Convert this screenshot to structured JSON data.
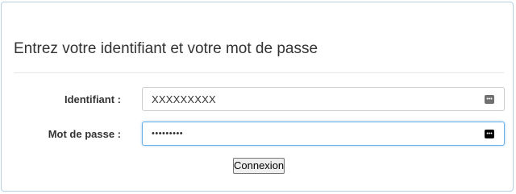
{
  "login_panel": {
    "title": "Entrez votre identifiant et votre mot de passe",
    "username_label": "Identifiant :",
    "username_value": "XXXXXXXXX",
    "password_label": "Mot de passe :",
    "password_value_masked": "•••••••••",
    "submit_label": "Connexion"
  },
  "icons": {
    "username_field_icon": "password-manager-icon",
    "password_field_icon": "password-manager-icon"
  },
  "colors": {
    "panel_border": "#b8d0e6",
    "focus_border": "#66afe9"
  }
}
